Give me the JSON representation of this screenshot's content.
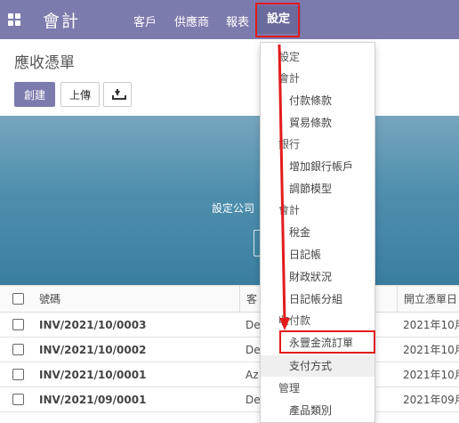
{
  "navbar": {
    "brand": "會計",
    "menu": [
      "客戶",
      "供應商",
      "報表",
      "設定"
    ],
    "active_menu": "設定",
    "color": "#7c7bad"
  },
  "page": {
    "title": "應收憑單",
    "create_label": "創建",
    "upload_label": "上傳",
    "download_icon": "download-icon"
  },
  "banner": {
    "text": "設定公司"
  },
  "table": {
    "headers": {
      "number": "號碼",
      "customer": "客",
      "date": "開立憑單日"
    },
    "rows": [
      {
        "number": "INV/2021/10/0003",
        "customer": "De",
        "date": "2021年10月"
      },
      {
        "number": "INV/2021/10/0002",
        "customer": "De",
        "date": "2021年10月"
      },
      {
        "number": "INV/2021/10/0001",
        "customer": "Az",
        "date": "2021年10月"
      },
      {
        "number": "INV/2021/09/0001",
        "customer": "De",
        "date": "2021年09月"
      }
    ]
  },
  "dropdown": {
    "items": [
      {
        "type": "header",
        "label": "設定"
      },
      {
        "type": "header",
        "label": "會計"
      },
      {
        "type": "link",
        "label": "付款條款"
      },
      {
        "type": "link",
        "label": "貿易條款"
      },
      {
        "type": "header",
        "label": "銀行"
      },
      {
        "type": "link",
        "label": "增加銀行帳戶"
      },
      {
        "type": "link",
        "label": "調節模型"
      },
      {
        "type": "header",
        "label": "會計"
      },
      {
        "type": "link",
        "label": "稅金"
      },
      {
        "type": "link",
        "label": "日記帳"
      },
      {
        "type": "link",
        "label": "財政狀況"
      },
      {
        "type": "link",
        "label": "日記帳分組"
      },
      {
        "type": "header",
        "label": "收付款"
      },
      {
        "type": "link",
        "label": "永豐金流訂單"
      },
      {
        "type": "link",
        "label": "支付方式"
      },
      {
        "type": "header",
        "label": "管理"
      },
      {
        "type": "link",
        "label": "產品類別"
      }
    ],
    "highlighted": "永豐金流訂單",
    "hovered": "支付方式"
  },
  "annotation_color": "#e31b1b"
}
